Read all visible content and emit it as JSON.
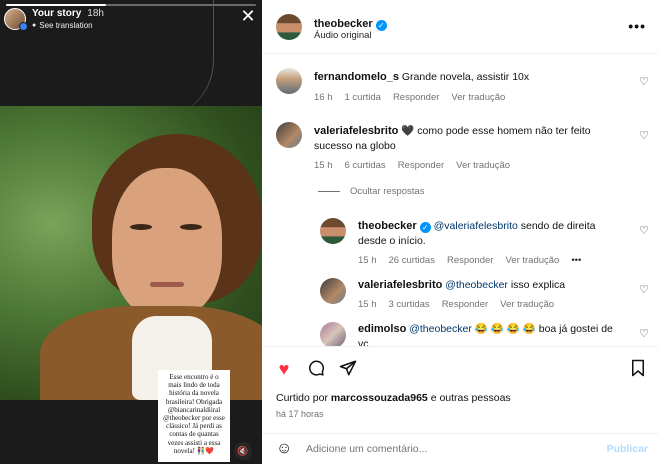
{
  "story": {
    "title": "Your story",
    "time": "18h",
    "translation": "See translation",
    "caption": "Esse encontro é o mais lindo de toda história da novela brasileira! Obrigada @biancarinaldiiral @theobecker por esse clássico! Já perdi as contas de quantas vezes assisti a essa novela! 👫❤️",
    "audio_icon": "muted-speaker-icon",
    "story_progress": 0.4
  },
  "post": {
    "author": "theobecker",
    "subtitle": "Áudio original"
  },
  "comments": [
    {
      "user": "fernandomelo_s",
      "text": "Grande novela, assistir 10x",
      "time": "16 h",
      "likes": "1 curtida",
      "reply": "Responder",
      "translate": "Ver tradução"
    },
    {
      "user": "valeriafelesbrito",
      "text_line1": "🖤 como pode esse homem não ter feito",
      "text_line2": "sucesso na globo",
      "time": "15 h",
      "likes": "6 curtidas",
      "reply": "Responder",
      "translate": "Ver tradução"
    }
  ],
  "hide_replies": "Ocultar respostas",
  "replies": [
    {
      "user": "theobecker",
      "mention": "@valeriafelesbrito",
      "text_line1": "sendo de direita",
      "text_line2": "desde o início.",
      "time": "15 h",
      "likes": "26 curtidas",
      "reply": "Responder",
      "translate": "Ver tradução",
      "more": "•••"
    },
    {
      "user": "valeriafelesbrito",
      "mention": "@theobecker",
      "text": "isso explica",
      "time": "15 h",
      "likes": "3 curtidas",
      "reply": "Responder",
      "translate": "Ver tradução"
    },
    {
      "user": "edimolso",
      "mention": "@theobecker",
      "text_line1": "😂 😂 😂 😂  boa já gostei de",
      "text_line2": "vc"
    }
  ],
  "actions": {
    "liked_prefix": "Curtido por",
    "liked_user": "marcossouzada965",
    "liked_suffix": "e outras pessoas",
    "time_ago": "há 17 horas"
  },
  "composer": {
    "placeholder": "Adicione um comentário...",
    "publish": "Publicar"
  }
}
